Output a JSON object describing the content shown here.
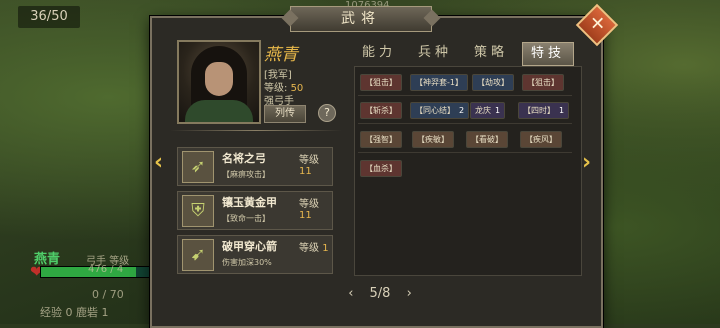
{
  "hud": {
    "counter": "36/50",
    "top_number": "1076394",
    "name": "燕青",
    "class": "弓手",
    "level_label": "等级",
    "hp_text": "476 / 4",
    "mp_text": "0 / 70",
    "exp_text": "经验 0 鹿砦 1"
  },
  "dialog": {
    "title": "武将",
    "close_label": "✕",
    "hero": {
      "name": "燕青",
      "faction": "[我军]",
      "level_label": "等级:",
      "level_value": "50",
      "unit_type": "强弓手",
      "bio_button": "列传",
      "help_label": "?"
    },
    "equipment": [
      {
        "name": "名将之弓",
        "level_label": "等级",
        "level_value": "11",
        "desc": "【麻痹攻击】",
        "icon": "bow-icon"
      },
      {
        "name": "镶玉黄金甲",
        "level_label": "等级",
        "level_value": "11",
        "desc": "【致命一击】",
        "icon": "armor-icon"
      },
      {
        "name": "破甲穿心箭",
        "level_label": "等级",
        "level_value": "1",
        "desc": "伤害加深30%",
        "icon": "arrow-icon"
      }
    ],
    "tabs": [
      "能力",
      "兵种",
      "策略",
      "特技"
    ],
    "active_tab": "特技",
    "skills": {
      "row1": [
        {
          "label": "【狙击】",
          "color": "red"
        },
        {
          "label": "【神羿套-1】",
          "color": "blue"
        },
        {
          "label": "【劫攻】",
          "color": "blue"
        },
        {
          "label": "【狙击】",
          "color": "red"
        }
      ],
      "row2": [
        {
          "label": "【斩杀】",
          "color": "red"
        },
        {
          "label": "【同心结】",
          "value": "2",
          "color": "blue"
        },
        {
          "label": "龙庆",
          "value": "1",
          "color": "purple"
        },
        {
          "label": "【四时】",
          "value": "1",
          "color": "purple"
        }
      ],
      "row3": [
        {
          "label": "【强智】",
          "color": "brown"
        },
        {
          "label": "【疾敏】",
          "color": "brown"
        },
        {
          "label": "【看破】",
          "color": "brown"
        },
        {
          "label": "【疾风】",
          "color": "brown"
        }
      ],
      "row4": [
        {
          "label": "【血杀】",
          "color": "red"
        }
      ]
    },
    "pager": {
      "prev": "‹",
      "current": "5/8",
      "next": "›"
    },
    "nav_left": "‹",
    "nav_right": "›"
  },
  "colors": {
    "accent_gold": "#e8b84a",
    "green_name": "#4fd06a",
    "close_orange": "#d9663a"
  }
}
